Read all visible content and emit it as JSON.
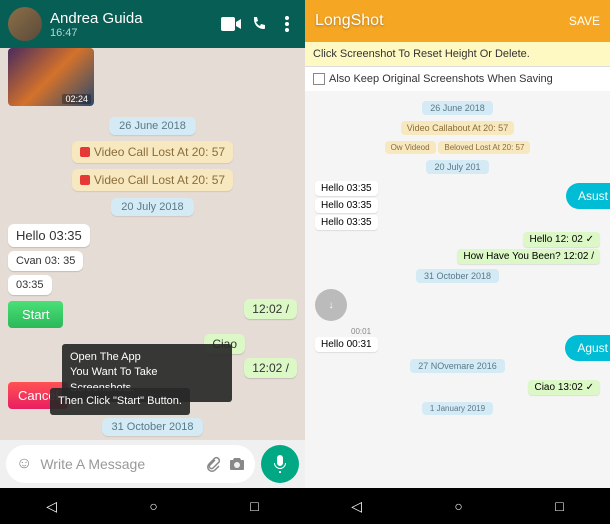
{
  "left": {
    "contact_name": "Andrea Guida",
    "header_time": "16:47",
    "media_time": "02:24",
    "date1": "26 June 2018",
    "vcall1": "Video Call Lost At 20: 57",
    "vcall2": "Video Call Lost At 20: 57",
    "date2": "20 July 2018",
    "msg_hello": "Hello 03:35",
    "msg_cvan": "Cvan 03: 35",
    "msg_time3": "03:35",
    "start_label": "Start",
    "cancel_label": "Cancel",
    "msg_ciao": "Ciao",
    "msg_t1": "12:02 /",
    "msg_t2": "12:02 /",
    "tip_line1": "Open The App",
    "tip_line2": "You Want To Take Screenshots.",
    "tip_line3": "Then Click \"Start\" Button.",
    "date3": "31 October 2018",
    "input_placeholder": "Write A Message"
  },
  "right": {
    "title": "LongShot",
    "save": "SAVE",
    "bar_text": "Click Screenshot To Reset Height Or Delete.",
    "check_text": "Also Keep Original Screenshots When Saving",
    "date1": "26 June 2018",
    "sys1": "Video Callabout At 20: 57",
    "sys2": "Ow Videod",
    "sys3": "Beloved Lost At 20: 57",
    "date2": "20 July  201",
    "h1": "Hello 03:35",
    "h2": "Hello 03:35",
    "h3": "Hello 03:35",
    "o1": "Hello 12: 02 ✓",
    "o2": "How Have You Been? 12:02 /",
    "date3": "31 October 2018",
    "audio_time": "00:01",
    "h4": "Hello 00:31",
    "date4": "27 NOvemare 2016",
    "o3": "Ciao 13:02 ✓",
    "date5": "1 January 2019",
    "fab1": "Asust",
    "fab2": "Agust"
  }
}
